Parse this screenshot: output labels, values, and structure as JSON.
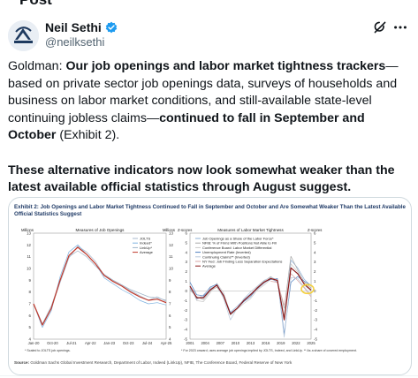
{
  "top_bar": {
    "title": "Post"
  },
  "author": {
    "name": "Neil Sethi",
    "handle": "@neilksethi"
  },
  "tweet": {
    "p1_lead": "Goldman: ",
    "p1_bold1": "Our job openings and labor market tightness trackers",
    "p1_mid": "—based on private sector job openings data, surveys of households and business on labor market conditions, and still-available state-level continuing jobless claims—",
    "p1_bold2": "continued to fall in September and October",
    "p1_tail": " (Exhibit 2).",
    "p2": "These alternative indicators now look somewhat weaker than the latest available official statistics through August suggest."
  },
  "exhibit": {
    "title": "Exhibit 2: Job Openings and Labor Market Tightness Continued to Fall in September and October and Are Somewhat Weaker Than the Latest Available Official Statistics Suggest",
    "source_label": "Source:",
    "source_text": "Goldman Sachs Global Investment Research, Department of Labor, Indeed (LinkUp), NFIB, The Conference Board, Federal Reserve of New York"
  },
  "chart_data": [
    {
      "type": "line",
      "title": "Measures of Job Openings",
      "ylabel_left": "Millions",
      "ylabel_right": "Millions",
      "y_ticks": [
        "13",
        "12",
        "11",
        "10",
        "9",
        "8",
        "7",
        "6",
        "5",
        "4"
      ],
      "ylim": [
        4,
        13
      ],
      "x_ticks": [
        "Jan-20",
        "Oct-20",
        "Jul-21",
        "Apr-22",
        "Jan-23",
        "Oct-23",
        "Jul-24",
        "Apr-25"
      ],
      "legend": [
        "JOLTS",
        "Indeed*",
        "LinkUp*",
        "Average"
      ],
      "footnote": "* Scaled to JOLTS job openings.",
      "series": [
        {
          "name": "JOLTS",
          "color": "#a8b8cc",
          "values": [
            7.0,
            5.2,
            6.6,
            8.8,
            10.9,
            11.9,
            11.4,
            10.6,
            9.4,
            9.0,
            8.6,
            8.1,
            7.7,
            7.3,
            7.6,
            7.2
          ]
        },
        {
          "name": "Indeed*",
          "color": "#7fb3e0",
          "values": [
            7.0,
            5.0,
            6.4,
            9.3,
            11.4,
            12.0,
            11.2,
            10.4,
            9.2,
            8.7,
            8.2,
            7.8,
            7.3,
            7.0,
            7.1,
            6.9
          ]
        },
        {
          "name": "LinkUp*",
          "color": "#9fb4c8",
          "values": [
            7.0,
            5.3,
            6.8,
            9.0,
            11.0,
            11.5,
            11.0,
            10.2,
            9.5,
            9.0,
            8.6,
            8.2,
            7.9,
            7.6,
            7.5,
            7.3
          ]
        },
        {
          "name": "Average",
          "color": "#c0392b",
          "values": [
            7.0,
            5.2,
            6.6,
            9.0,
            11.1,
            11.8,
            11.2,
            10.4,
            9.4,
            8.9,
            8.5,
            8.0,
            7.6,
            7.3,
            7.4,
            7.1
          ]
        }
      ]
    },
    {
      "type": "line",
      "title": "Measures of Labor Market Tightness",
      "ylabel_left": "Z-scores",
      "ylabel_right": "Z-scores",
      "y_ticks": [
        "6",
        "5",
        "4",
        "3",
        "2",
        "1",
        "0",
        "-1",
        "-2",
        "-3",
        "-4",
        "-5"
      ],
      "ylim": [
        -5,
        6
      ],
      "x_ticks": [
        "2001",
        "2004",
        "2007",
        "2010",
        "2013",
        "2016",
        "2019",
        "2022",
        "2025"
      ],
      "legend": [
        "Job Openings as a Share of the Labor Force*",
        "NFIB: % of Firms With Positions Not Able to Fill",
        "Conference Board: Labor Market Differential",
        "Unemployment Rate (Inverted)",
        "Continuing Claims** (Inverted)",
        "NY Fed: Job Finding Less Separation Expectations",
        "Average"
      ],
      "footnote": "* For 2023 onward, uses average job openings implied by JOLTS, Indeed, and LinkUp. ** As a share of covered employment.",
      "series": [
        {
          "name": "Job Openings as a Share of the Labor Force*",
          "color": "#8fb0d6",
          "values": [
            0.3,
            -0.8,
            -0.6,
            0.2,
            0.6,
            -0.4,
            -2.2,
            -1.6,
            -0.9,
            -0.3,
            0.2,
            0.8,
            1.3,
            0.9,
            -3.0,
            3.2,
            2.4,
            1.2,
            0.5
          ]
        },
        {
          "name": "NFIB: % of Firms With Positions Not Able to Fill",
          "color": "#a9a9a9",
          "values": [
            0.1,
            -0.6,
            -0.9,
            0.0,
            0.4,
            -0.6,
            -2.5,
            -1.9,
            -1.0,
            -0.4,
            0.4,
            1.0,
            1.5,
            1.0,
            -1.8,
            3.6,
            2.2,
            0.9,
            0.3
          ]
        },
        {
          "name": "Conference Board: Labor Market Differential",
          "color": "#c9c9c9",
          "values": [
            0.6,
            -1.0,
            -1.1,
            -0.2,
            0.8,
            -0.2,
            -2.4,
            -1.9,
            -1.3,
            -0.8,
            0.1,
            0.6,
            1.2,
            1.1,
            -2.6,
            2.8,
            2.0,
            0.6,
            0.0
          ]
        },
        {
          "name": "Unemployment Rate (Inverted)",
          "color": "#4f7fbf",
          "values": [
            0.9,
            -0.4,
            -0.5,
            0.4,
            0.7,
            -0.5,
            -2.3,
            -1.8,
            -1.1,
            -0.6,
            0.3,
            0.9,
            1.2,
            1.3,
            -4.5,
            0.9,
            1.5,
            1.0,
            0.6
          ]
        },
        {
          "name": "Continuing Claims** (Inverted)",
          "color": "#b7c7db",
          "values": [
            0.5,
            -0.9,
            -0.4,
            0.3,
            0.6,
            -0.8,
            -3.0,
            -1.8,
            -0.8,
            -0.1,
            0.5,
            1.1,
            1.4,
            1.2,
            -4.8,
            1.4,
            1.3,
            0.4,
            -0.4
          ]
        },
        {
          "name": "NY Fed: Job Finding Less Separation Expectations",
          "color": "#d8a4a4",
          "values": [
            null,
            null,
            null,
            null,
            null,
            null,
            null,
            null,
            null,
            null,
            null,
            null,
            1.0,
            0.9,
            -1.5,
            1.8,
            1.1,
            0.3,
            -0.6
          ]
        },
        {
          "name": "Average",
          "color": "#8b1a1a",
          "values": [
            0.5,
            -0.7,
            -0.7,
            0.1,
            0.6,
            -0.5,
            -2.4,
            -1.8,
            -1.0,
            -0.4,
            0.3,
            0.9,
            1.3,
            1.1,
            -3.0,
            2.4,
            1.8,
            0.7,
            0.1
          ]
        }
      ]
    }
  ]
}
